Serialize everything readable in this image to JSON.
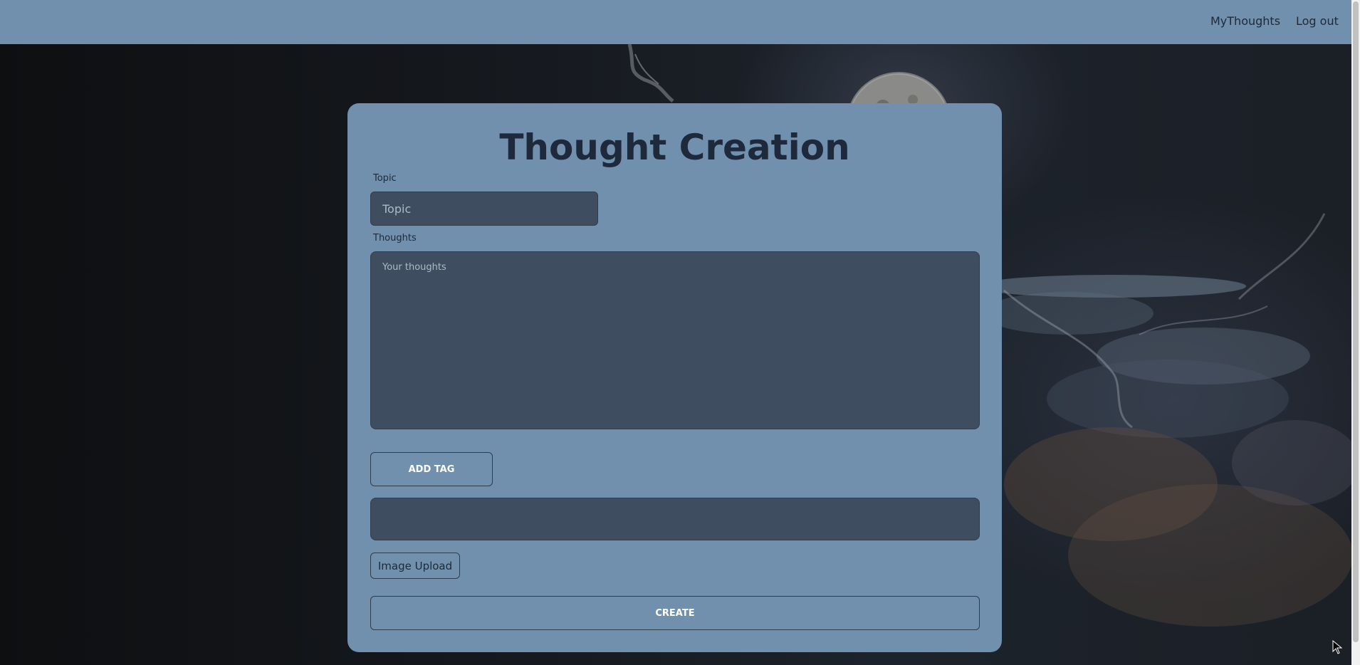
{
  "navbar": {
    "links": [
      "MyThoughts",
      "Log out"
    ]
  },
  "form": {
    "title": "Thought Creation",
    "topic_label": "Topic",
    "topic_placeholder": "Topic",
    "thoughts_label": "Thoughts",
    "thoughts_placeholder": "Your thoughts",
    "add_tag_label": "ADD TAG",
    "image_upload_label": "Image Upload",
    "create_label": "CREATE"
  },
  "icons": {
    "cursor": "mouse-pointer-icon"
  },
  "colors": {
    "navbar_bg": "#7090ad",
    "card_bg": "#7090ad",
    "input_bg": "#3e4e60",
    "title_text": "#1e293b"
  }
}
